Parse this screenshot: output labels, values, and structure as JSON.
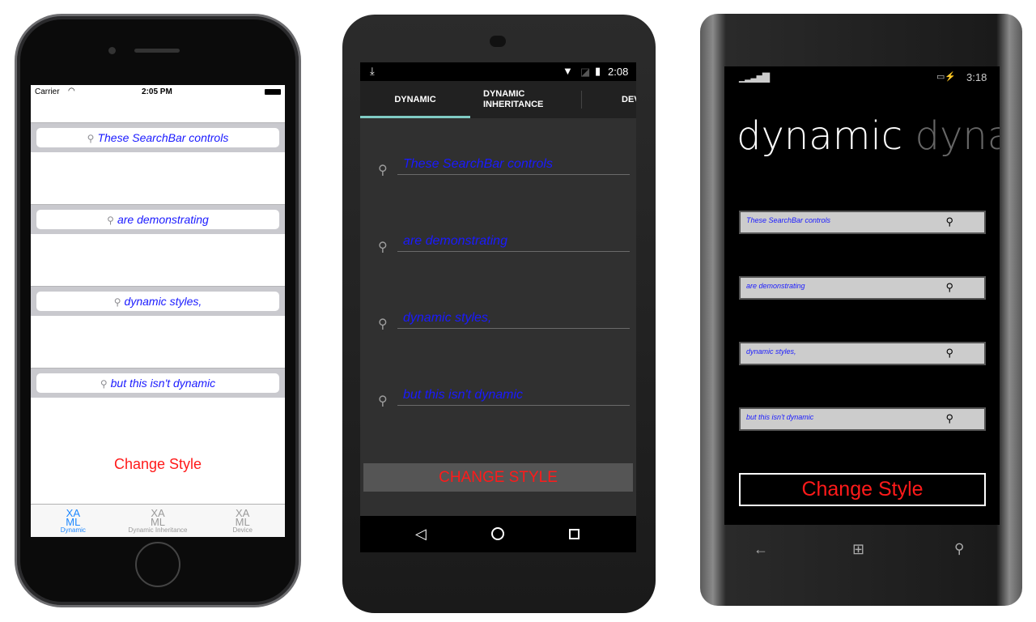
{
  "ios": {
    "carrier": "Carrier",
    "time": "2:05 PM",
    "searchbars": [
      "These SearchBar controls",
      "are demonstrating",
      "dynamic styles,",
      "but this isn't dynamic"
    ],
    "change_style": "Change Style",
    "tabs": [
      {
        "icon": "XA ML",
        "label": "Dynamic"
      },
      {
        "icon": "XA ML",
        "label": "Dynamic Inheritance"
      },
      {
        "icon": "XA ML",
        "label": "Device"
      }
    ]
  },
  "android": {
    "time": "2:08",
    "tabs": [
      "DYNAMIC",
      "DYNAMIC INHERITANCE",
      "DEV"
    ],
    "searchbars": [
      "These SearchBar controls",
      "are demonstrating",
      "dynamic styles,",
      "but this isn't dynamic"
    ],
    "change_style": "CHANGE STYLE"
  },
  "windows": {
    "time": "3:18",
    "title": "dynamic",
    "title_next": "dynami",
    "searchbars": [
      "These SearchBar controls",
      "are demonstrating",
      "dynamic styles,",
      "but this isn't dynamic"
    ],
    "change_style": "Change Style"
  },
  "colors": {
    "text_blue": "#1a1aff",
    "button_red": "#ff1a1a",
    "android_indicator": "#80cbc4",
    "ios_tab_active": "#1e88ff"
  }
}
